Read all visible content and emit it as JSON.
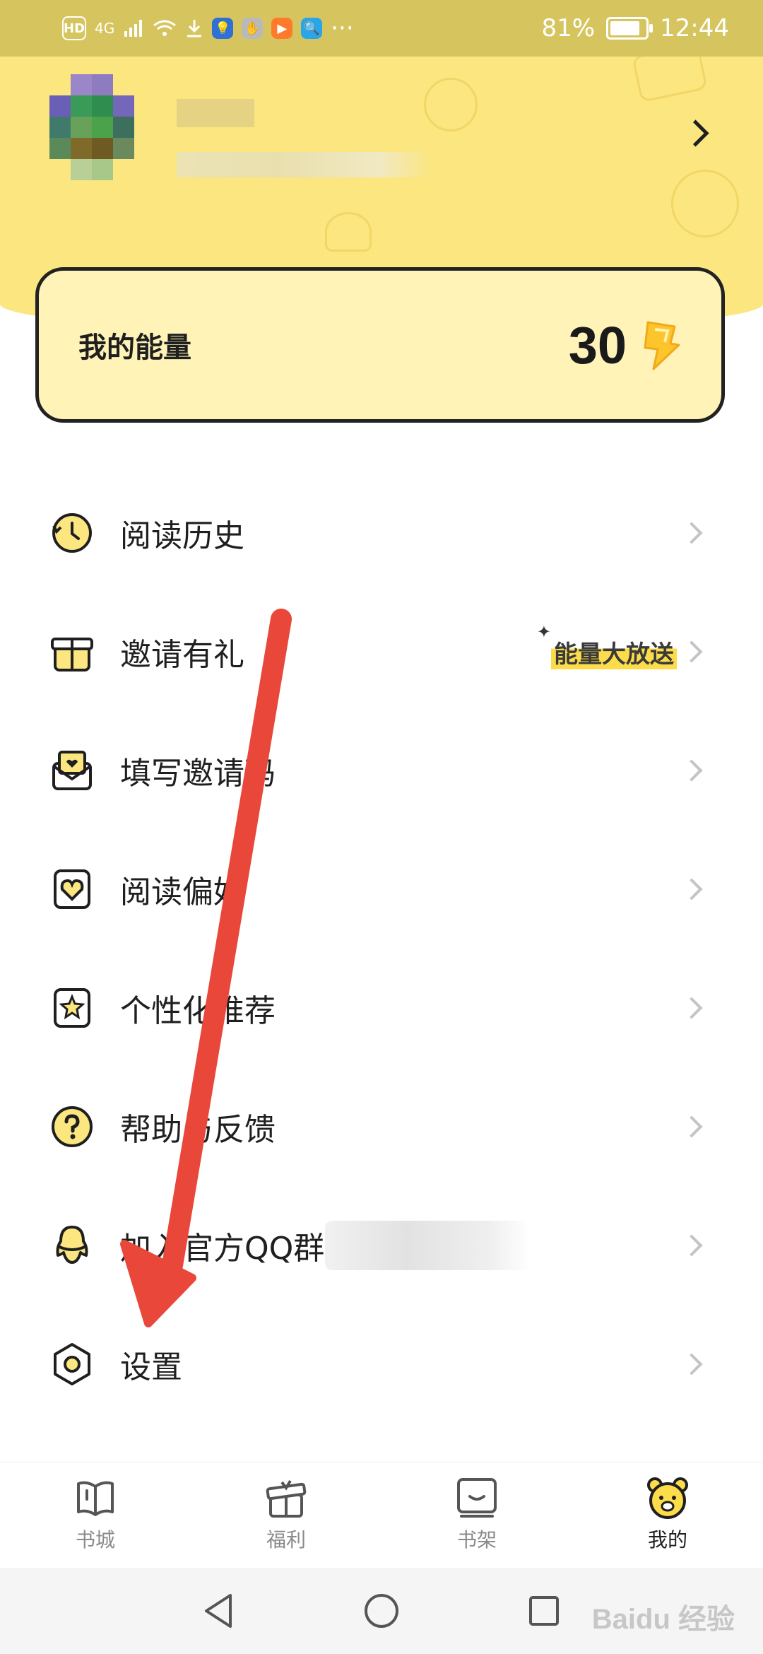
{
  "status_bar": {
    "left_badges": [
      "HD",
      "4G"
    ],
    "battery": "81%",
    "time": "12:44",
    "more": "···"
  },
  "profile": {},
  "energy": {
    "label": "我的能量",
    "value": "30",
    "icon": "lightning-bolt-icon"
  },
  "menu": [
    {
      "label": "阅读历史",
      "icon": "clock-history-icon"
    },
    {
      "label": "邀请有礼",
      "icon": "gift-icon",
      "badge": "能量大放送"
    },
    {
      "label": "填写邀请码",
      "icon": "envelope-heart-icon"
    },
    {
      "label": "阅读偏好",
      "icon": "heart-tag-icon"
    },
    {
      "label": "个性化推荐",
      "icon": "star-card-icon"
    },
    {
      "label": "帮助与反馈",
      "icon": "question-circle-icon"
    },
    {
      "label": "加入官方QQ群",
      "icon": "qq-penguin-icon"
    },
    {
      "label": "设置",
      "icon": "hexagon-gear-icon"
    }
  ],
  "bottom_nav": [
    {
      "label": "书城",
      "icon": "book-icon",
      "active": false
    },
    {
      "label": "福利",
      "icon": "gift-box-icon",
      "active": false
    },
    {
      "label": "书架",
      "icon": "bookshelf-icon",
      "active": false
    },
    {
      "label": "我的",
      "icon": "bear-face-icon",
      "active": true
    }
  ],
  "system_nav": [
    "back-triangle-icon",
    "home-circle-icon",
    "recents-square-icon"
  ],
  "watermark": "Baidu 经验",
  "colors": {
    "header_yellow": "#fbe680",
    "status_bar": "#d6c55f",
    "card_bg": "#fff3b8",
    "accent_yellow": "#fbdc4a",
    "arrow_red": "#e8473a"
  }
}
